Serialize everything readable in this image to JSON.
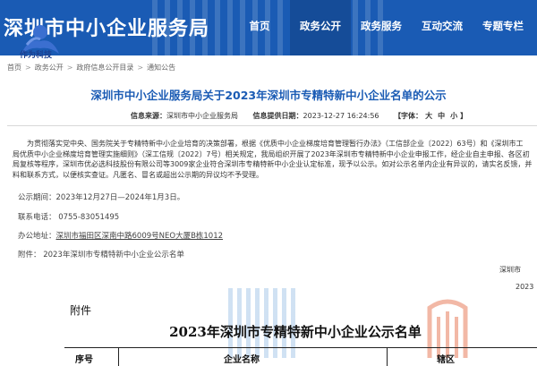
{
  "header": {
    "site_title": "深圳市中小企业服务局",
    "logo_text": "作为科技",
    "nav": [
      {
        "label": "首页"
      },
      {
        "label": "政务公开",
        "active": true
      },
      {
        "label": "政务服务"
      },
      {
        "label": "互动交流"
      },
      {
        "label": "专题专栏"
      }
    ]
  },
  "breadcrumb": [
    "首页",
    "政务公开",
    "政府信息公开目录",
    "通知公告"
  ],
  "article": {
    "title": "深圳市中小企业服务局关于2023年深圳市专精特新中小企业名单的公示",
    "source_label": "信息来源：",
    "source_value": "深圳市中小企业服务局",
    "date_label": "信息提供日期：",
    "date_value": "2023-12-27 16:24:56",
    "font_label": "【字体：",
    "font_options": [
      "大",
      "中",
      "小"
    ],
    "font_end": "】",
    "body_lines": [
      "为贯彻落实党中央、国务院关于专精特新中小企业培育的决策部署，根据《优质中小企业梯度培育管理暂行办法》（工信部企业〔2022〕63号）和《深圳市工",
      "局优质中小企业梯度培育管理实施细则》（深工信规〔2022〕7号）相关规定，我局组织开展了2023年深圳市专精特新中小企业申报工作，经企业自主申报、各区初",
      "局复核等程序，深圳市优必选科技股份有限公司等3009家企业符合深圳市专精特新中小企业认定标准，现予以公示。如对公示名单内企业有异议的，请实名反馈，并",
      "料和联系方式，以便核实查证。凡匿名、冒名或超出公示期的异议均不予受理。"
    ],
    "period": "公示期间：2023年12月27日—2024年1月3日。",
    "phone": "联系电话：   0755-83051495",
    "address_label": "办公地址：",
    "address_value": "深圳市福田区深南中路6009号NEO大厦B栋1012",
    "attachment_line": "附件：  2023年深圳市专精特新中小企业公示名单",
    "signature": "深圳市",
    "sign_date": "2023"
  },
  "attachment_doc": {
    "label": "附件",
    "title": "2023年深圳市专精特新中小企业公示名单",
    "headers": [
      "序号",
      "企业名称",
      "辖区"
    ]
  },
  "colors": {
    "header_blue": "#1a5bb4",
    "nav_active": "#154c98",
    "title_blue": "#1a5bb4"
  }
}
